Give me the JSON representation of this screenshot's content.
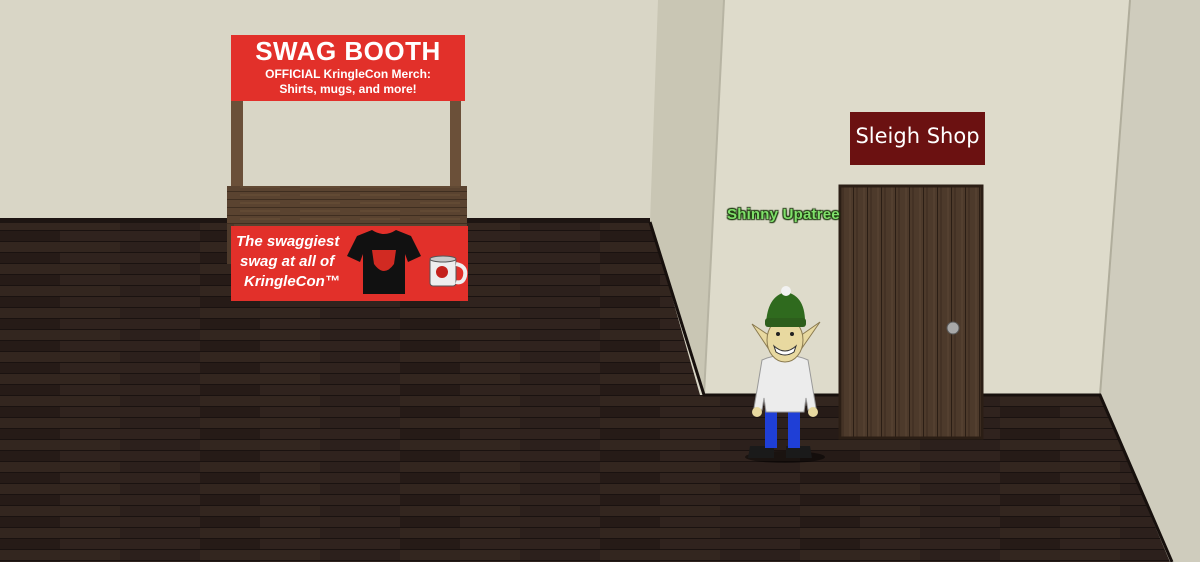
{
  "swag_booth": {
    "title": "SWAG BOOTH",
    "subtitle_line1": "OFFICIAL KringleCon Merch:",
    "subtitle_line2": "Shirts, mugs, and more!",
    "counter_line1": "The swaggiest",
    "counter_line2": "swag at all of",
    "counter_line3": "KringleCon™"
  },
  "sleigh_shop": {
    "sign": "Sleigh Shop"
  },
  "npc": {
    "name": "Shinny Upatree"
  },
  "colors": {
    "wall": "#d9d6c6",
    "floor": "#2a1e1a",
    "booth_red": "#e2302a",
    "sign_bg": "#6b1111",
    "npc_name": "#7fe06a"
  }
}
